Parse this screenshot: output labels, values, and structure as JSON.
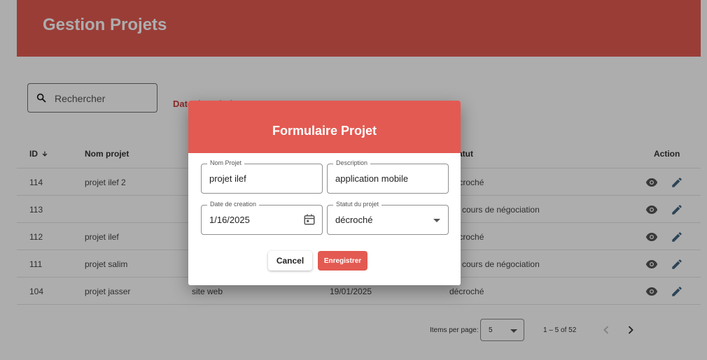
{
  "header": {
    "title": "Gestion Projets"
  },
  "search": {
    "placeholder": "Rechercher"
  },
  "filter": {
    "date_label": "Date de création"
  },
  "table": {
    "columns": {
      "id": "ID",
      "name": "Nom projet",
      "status": "Statut",
      "action": "Action"
    },
    "rows": [
      {
        "id": "114",
        "name": "projet ilef 2",
        "description": "",
        "date": "",
        "status": "décroché"
      },
      {
        "id": "113",
        "name": "",
        "description": "",
        "date": "",
        "status": "En cours de négociation"
      },
      {
        "id": "112",
        "name": "projet ilef",
        "description": "",
        "date": "",
        "status": "décroché"
      },
      {
        "id": "111",
        "name": "projet salim",
        "description": "",
        "date": "",
        "status": "En cours de négociation"
      },
      {
        "id": "104",
        "name": "projet jasser",
        "description": "site web",
        "date": "19/01/2025",
        "status": "décroché"
      }
    ]
  },
  "paginator": {
    "items_label": "Items per page:",
    "page_size": "5",
    "range": "1 – 5 of 52"
  },
  "dialog": {
    "title": "Formulaire Projet",
    "fields": {
      "name": {
        "label": "Nom Projet",
        "value": "projet ilef"
      },
      "description": {
        "label": "Description",
        "value": "application mobile"
      },
      "date": {
        "label": "Date de creation",
        "value": "1/16/2025"
      },
      "status": {
        "label": "Statut du projet",
        "value": "décroché"
      }
    },
    "cancel_label": "Cancel",
    "save_label": "Enregistrer"
  },
  "icons": {
    "search": "search-icon",
    "sort": "arrow-down-icon",
    "view": "eye-icon",
    "edit": "pencil-icon",
    "calendar": "calendar-icon",
    "prev": "chevron-left-icon",
    "next": "chevron-right-icon"
  },
  "colors": {
    "accent": "#e35a52",
    "accent_dark": "#c93f38"
  }
}
